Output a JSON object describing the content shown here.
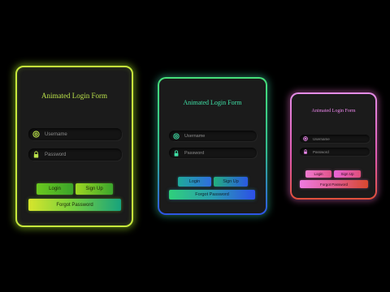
{
  "forms": [
    {
      "title": "Animated Login Form",
      "username_placeholder": "Username",
      "password_placeholder": "Password",
      "login_label": "Login",
      "signup_label": "Sign Up",
      "forgot_label": "Forgot Password",
      "accent_color": "#b9e04a",
      "border_color": "#c7e83c"
    },
    {
      "title": "Animated Login Form",
      "username_placeholder": "Username",
      "password_placeholder": "Password",
      "login_label": "Login",
      "signup_label": "Sign Up",
      "forgot_label": "Forgot Password",
      "accent_color": "#3fe0a6",
      "border_color": "#46e07a"
    },
    {
      "title": "Animated Login Form",
      "username_placeholder": "Username",
      "password_placeholder": "Password",
      "login_label": "Login",
      "signup_label": "Sign Up",
      "forgot_label": "Forgot Password",
      "accent_color": "#ee88ee",
      "border_color": "#e38ce6"
    }
  ],
  "icons": {
    "username": "at-icon",
    "password": "lock-icon"
  }
}
